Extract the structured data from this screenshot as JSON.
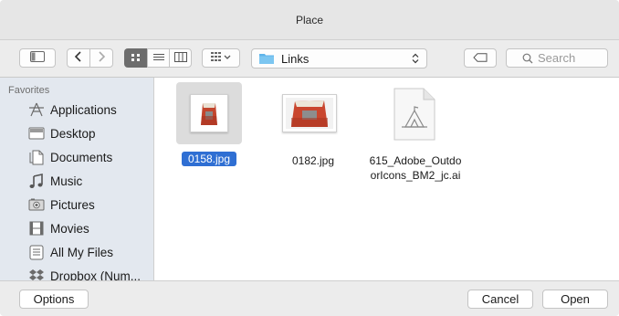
{
  "window": {
    "title": "Place"
  },
  "toolbar": {
    "location": "Links",
    "search_placeholder": "Search"
  },
  "sidebar": {
    "heading": "Favorites",
    "items": [
      {
        "label": "Applications",
        "icon": "applications-icon"
      },
      {
        "label": "Desktop",
        "icon": "desktop-icon"
      },
      {
        "label": "Documents",
        "icon": "documents-icon"
      },
      {
        "label": "Music",
        "icon": "music-icon"
      },
      {
        "label": "Pictures",
        "icon": "pictures-icon"
      },
      {
        "label": "Movies",
        "icon": "movies-icon"
      },
      {
        "label": "All My Files",
        "icon": "all-my-files-icon"
      },
      {
        "label": "Dropbox (Num...",
        "icon": "dropbox-icon"
      }
    ]
  },
  "files": [
    {
      "name": "0158.jpg",
      "selected": true
    },
    {
      "name": "0182.jpg",
      "selected": false
    },
    {
      "name": "615_Adobe_Outdo orIcons_BM2_jc.ai",
      "name_line1": "615_Adobe_Outdo",
      "name_line2": "orIcons_BM2_jc.ai",
      "selected": false
    }
  ],
  "bottom": {
    "options_label": "Options",
    "cancel_label": "Cancel",
    "open_label": "Open"
  },
  "colors": {
    "selection": "#2f6fd3",
    "sidebar_bg": "#e3e8ef",
    "folder_blue": "#5fb4ea"
  }
}
